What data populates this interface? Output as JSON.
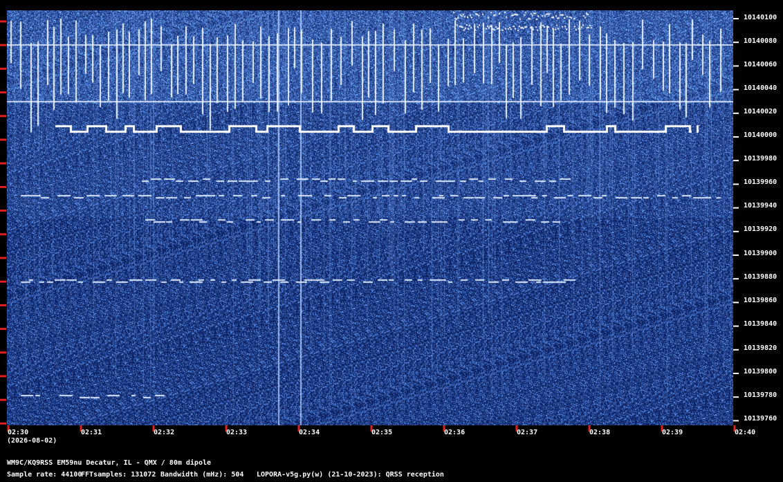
{
  "frequency_axis": {
    "labels": [
      "10140100",
      "10140080",
      "10140060",
      "10140040",
      "10140020",
      "10140000",
      "10139980",
      "10139960",
      "10139940",
      "10139920",
      "10139900",
      "10139880",
      "10139860",
      "10139840",
      "10139820",
      "10139800",
      "10139780",
      "10139760"
    ]
  },
  "time_axis": {
    "labels": [
      "02:30",
      "02:31",
      "02:32",
      "02:33",
      "02:34",
      "02:35",
      "02:36",
      "02:37",
      "02:38",
      "02:39",
      "02:40"
    ],
    "date": "(2026-08-02)"
  },
  "footer": {
    "station": "WM9C/KQ9RSS EM59nu Decatur, IL - QMX / 80m dipole",
    "sample_rate": "Sample rate: 44100",
    "fft_samples": "FFTsamples: 131072",
    "bandwidth": "Bandwidth (mHz): 504",
    "software": "LOPORA-v5g.py(w) (21-10-2023): QRSS reception"
  },
  "colors": {
    "background": "#000000",
    "spectrum_base": "#0a2a6e",
    "tick": "#e02020",
    "text": "#ffffff"
  }
}
